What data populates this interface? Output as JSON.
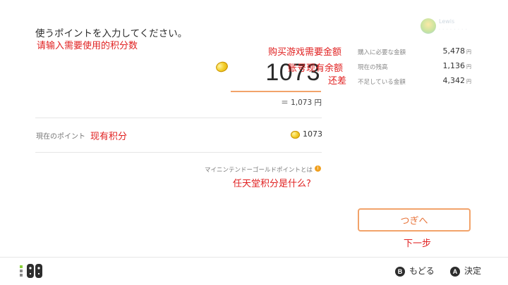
{
  "title": "使うポイントを入力してください。",
  "annotations": {
    "input_points": "请输入需要使用的积分数",
    "need_amount": "购买游戏需要金额",
    "current_balance": "账号现有余额",
    "shortfall": "还差",
    "current_points": "现有积分",
    "what_is_gold": "任天堂积分是什么?",
    "next": "下一步"
  },
  "input": {
    "value": "1073",
    "yen_equivalent": "＝ 1,073 円"
  },
  "current_points": {
    "label": "現在のポイント",
    "value": "1073"
  },
  "gold_point_link": {
    "label": "マイニンテンドーゴールドポイントとは",
    "info_icon": "info-icon"
  },
  "profile": {
    "name": "Lewis",
    "sub": "- - - - - - - -"
  },
  "summary": [
    {
      "label": "購入に必要な金額",
      "value": "5,478",
      "unit": "円"
    },
    {
      "label": "現在の残高",
      "value": "1,136",
      "unit": "円"
    },
    {
      "label": "不足している金額",
      "value": "4,342",
      "unit": "円"
    }
  ],
  "next_button": {
    "label": "つぎへ"
  },
  "footer": {
    "back": {
      "key": "B",
      "label": "もどる"
    },
    "ok": {
      "key": "A",
      "label": "決定"
    }
  },
  "colors": {
    "accent": "#f2a36a",
    "annotation": "#e02020",
    "coin": "#f4cf2a"
  }
}
